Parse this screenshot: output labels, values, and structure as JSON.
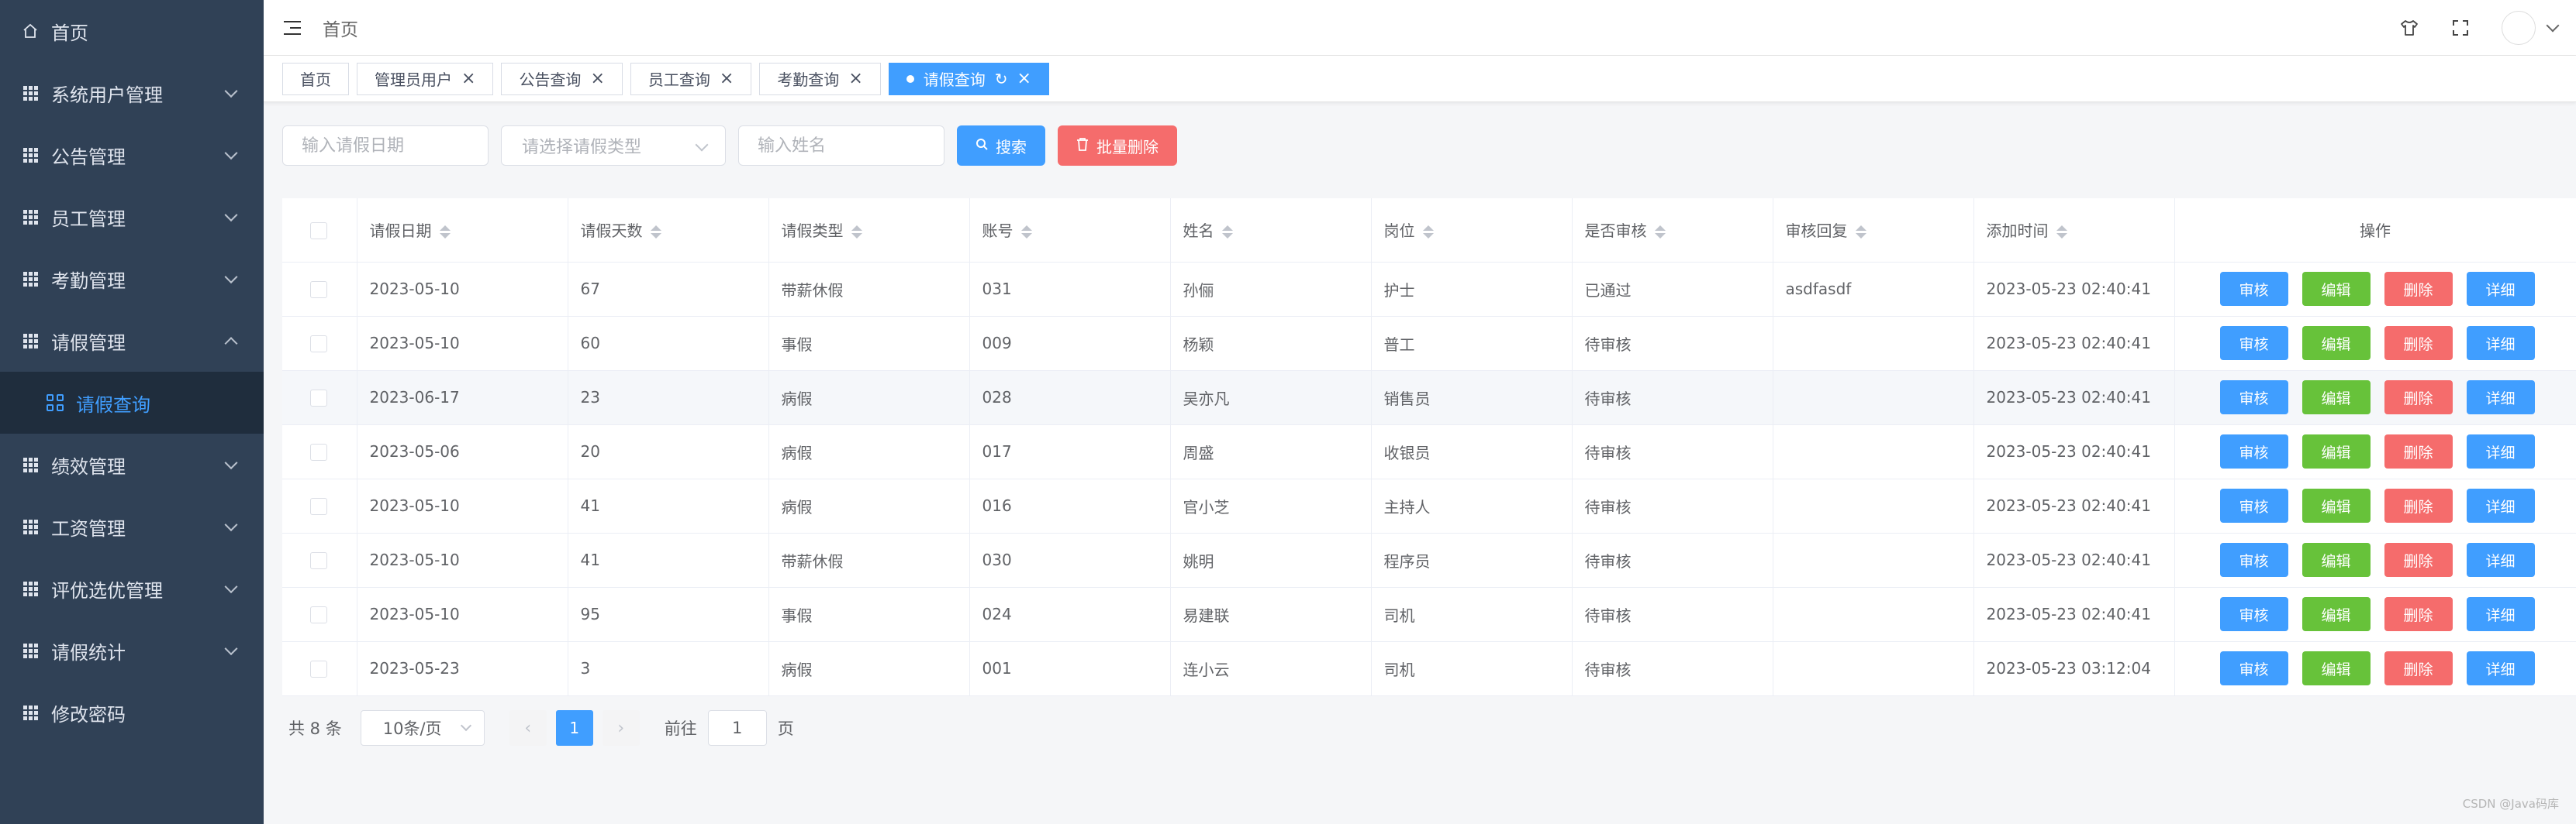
{
  "sidebar": {
    "items": [
      {
        "label": "首页",
        "icon": "home-icon"
      },
      {
        "label": "系统用户管理",
        "icon": "grid-icon"
      },
      {
        "label": "公告管理",
        "icon": "grid-icon"
      },
      {
        "label": "员工管理",
        "icon": "grid-icon"
      },
      {
        "label": "考勤管理",
        "icon": "grid-icon"
      },
      {
        "label": "请假管理",
        "icon": "grid-icon",
        "expanded": true
      },
      {
        "label": "请假查询",
        "icon": "grid4-icon",
        "active": true
      },
      {
        "label": "绩效管理",
        "icon": "grid-icon"
      },
      {
        "label": "工资管理",
        "icon": "grid-icon"
      },
      {
        "label": "评优选优管理",
        "icon": "grid-icon"
      },
      {
        "label": "请假统计",
        "icon": "grid-icon"
      },
      {
        "label": "修改密码",
        "icon": "grid-icon"
      }
    ]
  },
  "header": {
    "breadcrumb": "首页"
  },
  "tags": [
    {
      "label": "首页"
    },
    {
      "label": "管理员用户"
    },
    {
      "label": "公告查询"
    },
    {
      "label": "员工查询"
    },
    {
      "label": "考勤查询"
    },
    {
      "label": "请假查询",
      "active": true
    }
  ],
  "filters": {
    "date_placeholder": "输入请假日期",
    "type_placeholder": "请选择请假类型",
    "name_placeholder": "输入姓名",
    "search_label": "搜索",
    "batch_delete_label": "批量删除"
  },
  "table": {
    "columns": [
      "请假日期",
      "请假天数",
      "请假类型",
      "账号",
      "姓名",
      "岗位",
      "是否审核",
      "审核回复",
      "添加时间",
      "操作"
    ],
    "rows": [
      {
        "date": "2023-05-10",
        "days": "67",
        "type": "带薪休假",
        "account": "031",
        "name": "孙俪",
        "post": "护士",
        "status": "已通过",
        "reply": "asdfasdf",
        "added": "2023-05-23 02:40:41"
      },
      {
        "date": "2023-05-10",
        "days": "60",
        "type": "事假",
        "account": "009",
        "name": "杨颖",
        "post": "普工",
        "status": "待审核",
        "reply": "",
        "added": "2023-05-23 02:40:41"
      },
      {
        "date": "2023-06-17",
        "days": "23",
        "type": "病假",
        "account": "028",
        "name": "吴亦凡",
        "post": "销售员",
        "status": "待审核",
        "reply": "",
        "added": "2023-05-23 02:40:41"
      },
      {
        "date": "2023-05-06",
        "days": "20",
        "type": "病假",
        "account": "017",
        "name": "周盛",
        "post": "收银员",
        "status": "待审核",
        "reply": "",
        "added": "2023-05-23 02:40:41"
      },
      {
        "date": "2023-05-10",
        "days": "41",
        "type": "病假",
        "account": "016",
        "name": "官小芝",
        "post": "主持人",
        "status": "待审核",
        "reply": "",
        "added": "2023-05-23 02:40:41"
      },
      {
        "date": "2023-05-10",
        "days": "41",
        "type": "带薪休假",
        "account": "030",
        "name": "姚明",
        "post": "程序员",
        "status": "待审核",
        "reply": "",
        "added": "2023-05-23 02:40:41"
      },
      {
        "date": "2023-05-10",
        "days": "95",
        "type": "事假",
        "account": "024",
        "name": "易建联",
        "post": "司机",
        "status": "待审核",
        "reply": "",
        "added": "2023-05-23 02:40:41"
      },
      {
        "date": "2023-05-23",
        "days": "3",
        "type": "病假",
        "account": "001",
        "name": "连小云",
        "post": "司机",
        "status": "待审核",
        "reply": "",
        "added": "2023-05-23 03:12:04"
      }
    ],
    "actions": [
      "审核",
      "编辑",
      "删除",
      "详细"
    ]
  },
  "pagination": {
    "total_label": "共 8 条",
    "page_size": "10条/页",
    "current_page": "1",
    "goto_prefix": "前往",
    "goto_value": "1",
    "goto_suffix": "页"
  },
  "watermark": "CSDN @Java码库",
  "colors": {
    "sidebar_bg": "#304156",
    "primary": "#409eff",
    "success": "#67c23a",
    "danger": "#f56c6c"
  }
}
